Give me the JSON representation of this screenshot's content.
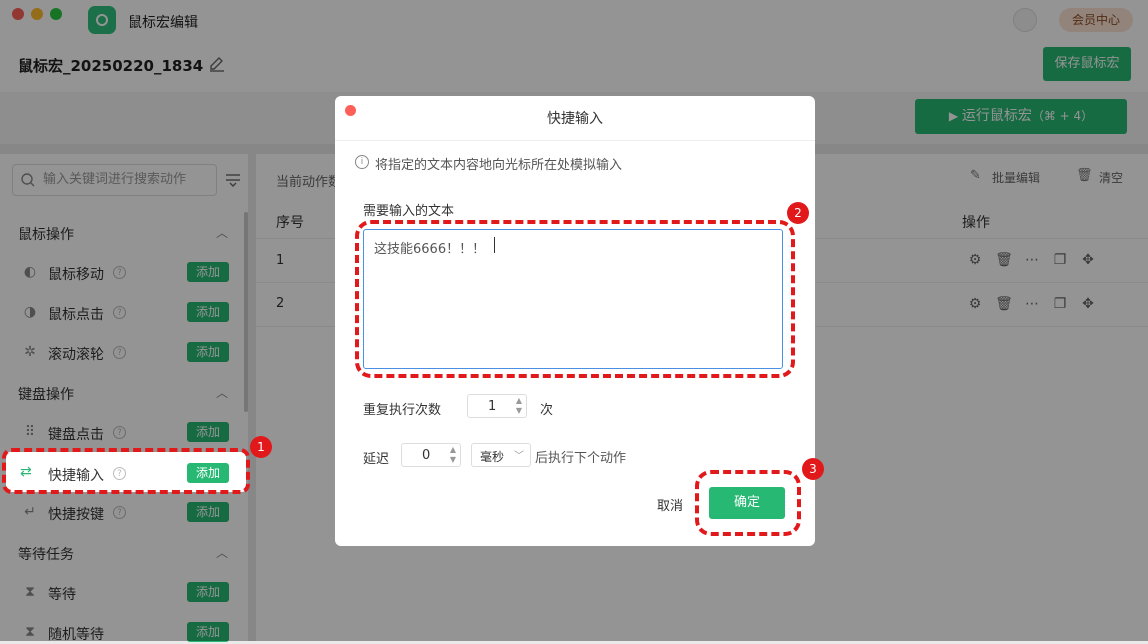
{
  "app": {
    "title": "鼠标宏编辑",
    "vip_label": "会员中心"
  },
  "header": {
    "macro_name": "鼠标宏_20250220_1834",
    "save_label": "保存鼠标宏"
  },
  "toolbar": {
    "run_label": "运行鼠标宏",
    "run_shortcut": "（⌘ + 4）"
  },
  "sidebar": {
    "search_placeholder": "输入关键词进行搜索动作",
    "add_label": "添加",
    "categories": [
      {
        "label": "鼠标操作",
        "items": [
          "鼠标移动",
          "鼠标点击",
          "滚动滚轮"
        ]
      },
      {
        "label": "键盘操作",
        "items": [
          "键盘点击",
          "快捷输入",
          "快捷按键"
        ]
      },
      {
        "label": "等待任务",
        "items": [
          "等待",
          "随机等待"
        ]
      }
    ]
  },
  "main": {
    "current_label": "当前动作数",
    "batch_edit": "批量编辑",
    "clear": "清空",
    "columns": {
      "index": "序号",
      "ops": "操作"
    },
    "rows": [
      "1",
      "2"
    ]
  },
  "dialog": {
    "title": "快捷输入",
    "info": "将指定的文本内容地向光标所在处模拟输入",
    "text_label": "需要输入的文本",
    "text_value": "这技能6666！！！",
    "repeat_label": "重复执行次数",
    "repeat_value": "1",
    "repeat_unit": "次",
    "delay_label": "延迟",
    "delay_value": "0",
    "delay_unit": "毫秒",
    "delay_suffix": "后执行下个动作",
    "cancel_label": "取消",
    "confirm_label": "确定"
  },
  "annotations": [
    "1",
    "2",
    "3"
  ],
  "colors": {
    "accent": "#27b874",
    "annotation": "#e2191b"
  }
}
